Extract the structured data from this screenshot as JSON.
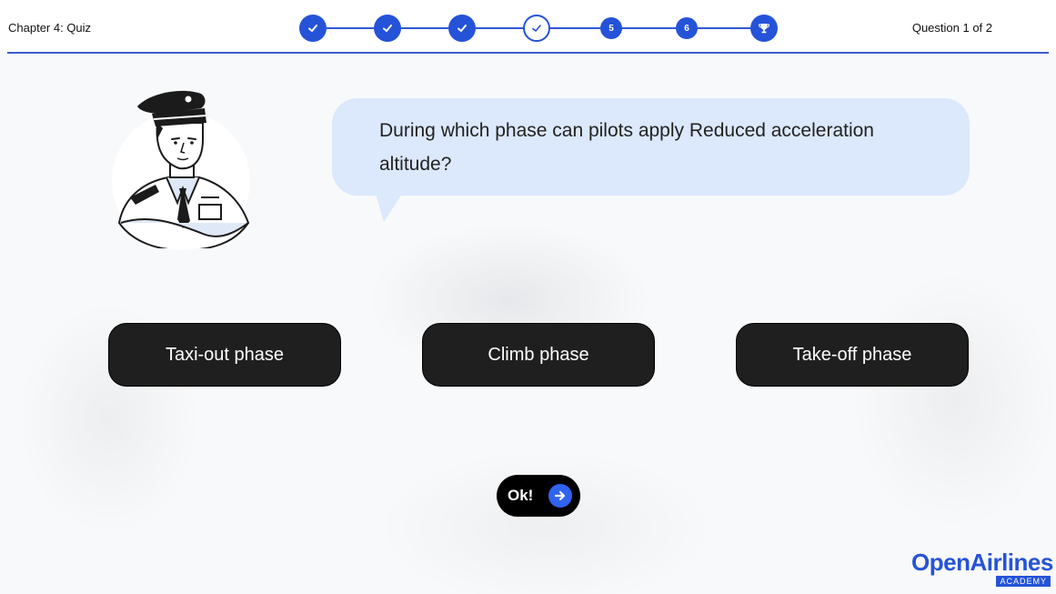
{
  "header": {
    "chapter_title": "Chapter 4: Quiz",
    "question_counter": "Question 1 of 2",
    "steps": [
      {
        "state": "done",
        "label": ""
      },
      {
        "state": "done",
        "label": ""
      },
      {
        "state": "done",
        "label": ""
      },
      {
        "state": "current",
        "label": ""
      },
      {
        "state": "upcoming",
        "label": "5"
      },
      {
        "state": "upcoming",
        "label": "6"
      },
      {
        "state": "final",
        "label": ""
      }
    ]
  },
  "question": {
    "text": "During which phase can pilots apply Reduced acceleration altitude?"
  },
  "answers": [
    {
      "label": "Taxi-out phase"
    },
    {
      "label": "Climb phase"
    },
    {
      "label": "Take-off phase"
    }
  ],
  "submit": {
    "label": "Ok!"
  },
  "logo": {
    "main": "OpenAirlines",
    "sub": "ACADEMY"
  },
  "colors": {
    "accent": "#2553d8",
    "bubble": "#dce8fb",
    "answer_bg": "#1f1f1f"
  }
}
